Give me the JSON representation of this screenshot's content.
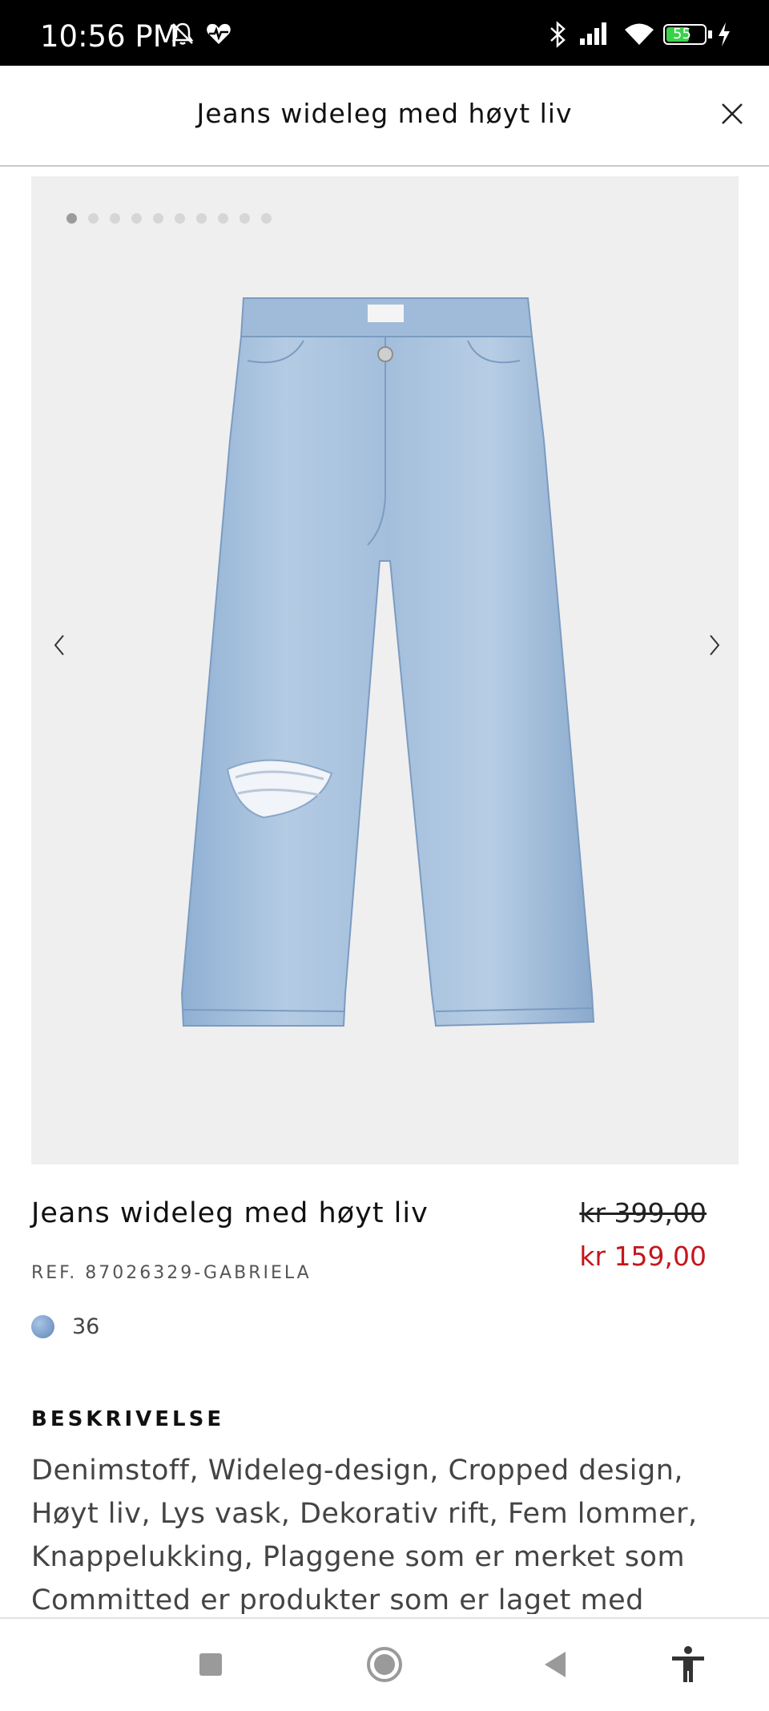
{
  "status_bar": {
    "time": "10:56 PM",
    "battery": "55"
  },
  "header": {
    "title": "Jeans wideleg med høyt liv"
  },
  "gallery": {
    "image_count": 10,
    "current_index": 1
  },
  "product": {
    "name": "Jeans wideleg med høyt liv",
    "price_original": "kr 399,00",
    "price_sale": "kr 159,00",
    "reference": "REF. 87026329-GABRIELA",
    "size": "36"
  },
  "description": {
    "title": "BESKRIVELSE",
    "text": "Denimstoff, Wideleg-design, Cropped design, Høyt liv, Lys vask, Dekorativ rift, Fem lommer, Knappelukking, Plaggene som er merket som Committed er produkter som er laget med"
  },
  "colors": {
    "sale_price": "#c4161c",
    "swatch": "#7fa3cf",
    "denim": "#a8c3de"
  }
}
